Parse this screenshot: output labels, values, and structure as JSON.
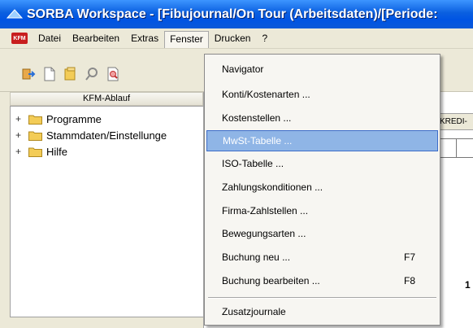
{
  "window": {
    "title": "SORBA Workspace - [Fibujournal/On Tour (Arbeitsdaten)/[Periode:"
  },
  "menubar": {
    "logo_text": "KFM",
    "items": [
      "Datei",
      "Bearbeiten",
      "Extras",
      "Fenster",
      "Drucken",
      "?"
    ],
    "active_index": 3
  },
  "panel": {
    "header": "KFM-Ablauf"
  },
  "tree": {
    "items": [
      {
        "expander": "+",
        "label": "Programme"
      },
      {
        "expander": "+",
        "label": "Stammdaten/Einstellunge"
      },
      {
        "expander": "+",
        "label": "Hilfe"
      }
    ]
  },
  "background": {
    "tab_fragment": "KREDI-",
    "page_fragment": "1"
  },
  "dropdown": {
    "items": [
      {
        "label": "Navigator",
        "shortcut": ""
      },
      {
        "label": "Konti/Kostenarten ...",
        "shortcut": ""
      },
      {
        "label": "Kostenstellen ...",
        "shortcut": ""
      },
      {
        "label": "MwSt-Tabelle ...",
        "shortcut": "",
        "highlighted": true
      },
      {
        "label": "ISO-Tabelle ...",
        "shortcut": ""
      },
      {
        "label": "Zahlungskonditionen ...",
        "shortcut": ""
      },
      {
        "label": "Firma-Zahlstellen ...",
        "shortcut": ""
      },
      {
        "label": "Bewegungsarten ...",
        "shortcut": ""
      },
      {
        "label": "Buchung neu ...",
        "shortcut": "F7"
      },
      {
        "label": "Buchung bearbeiten ...",
        "shortcut": "F8"
      },
      {
        "label": "Zusatzjournale",
        "shortcut": ""
      }
    ]
  },
  "colors": {
    "titlebar": "#0054e3",
    "highlight": "#8fb5e6",
    "folder": "#f3cc57"
  },
  "icons": [
    "app-logo-icon",
    "exit-icon",
    "new-document-icon",
    "open-folder-icon",
    "search-icon",
    "print-preview-icon",
    "folder-icon"
  ]
}
